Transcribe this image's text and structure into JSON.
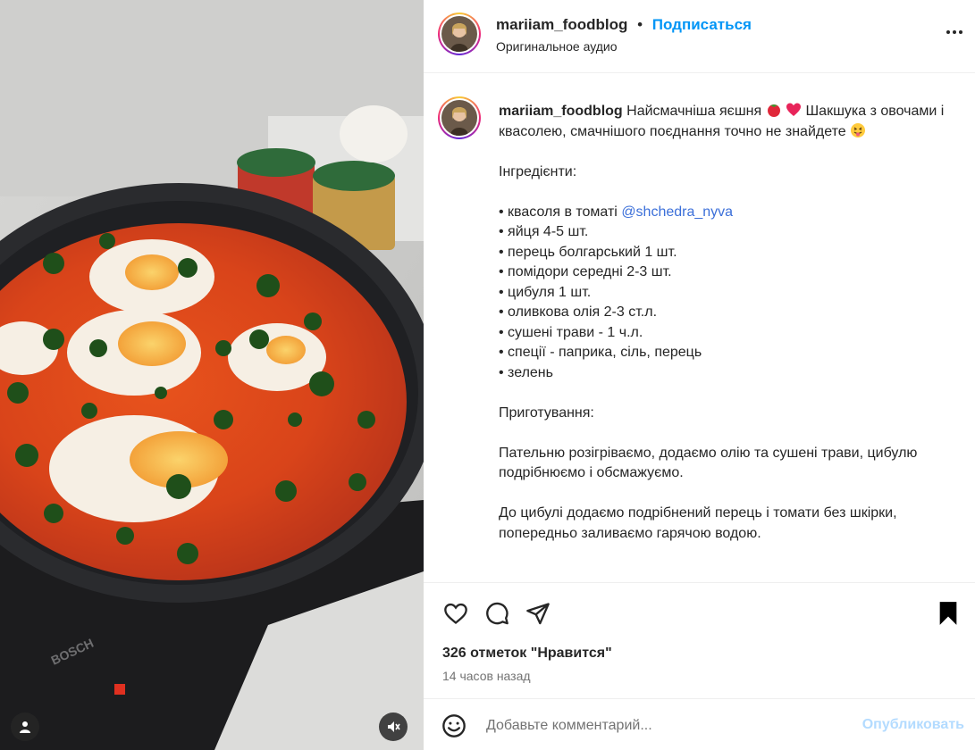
{
  "header": {
    "username": "mariiam_foodblog",
    "dot": "•",
    "follow_label": "Подписаться",
    "audio_label": "Оригинальное аудио",
    "more_icon": "more-horizontal-icon"
  },
  "caption": {
    "username": "mariiam_foodblog",
    "line1": "Найсмачніша яєшня",
    "line1b": "Шакшука з овочами і квасолею, смачнішого поєднання точно не знайдете",
    "ingredients_title": "Інгредієнти:",
    "items": {
      "i1": "• квасоля в томаті",
      "i1_mention": "@shchedra_nyva",
      "i2": "• яйця 4-5 шт.",
      "i3": "• перець болгарський 1 шт.",
      "i4": "• помідори середні 2-3 шт.",
      "i5": "• цибуля 1 шт.",
      "i6": "• оливкова олія 2-3 ст.л.",
      "i7": "• сушені трави - 1 ч.л.",
      "i8": "• спеції - паприка, сіль, перець",
      "i9": "• зелень"
    },
    "prep_title": "Приготування:",
    "step1": "Пательню розігріваємо, додаємо олію та сушені трави, цибулю подрібнюємо і обсмажуємо.",
    "step2": "До цибулі додаємо подрібнений перець і томати без шкірки, попередньо заливаємо гарячою водою."
  },
  "actions": {
    "likes": "326 отметок \"Нравится\"",
    "time": "14 часов назад"
  },
  "comment": {
    "placeholder": "Добавьте комментарий...",
    "publish_label": "Опубликовать"
  },
  "media": {
    "stove_brand": "BOSCH"
  },
  "colors": {
    "follow": "#0095f6",
    "mention": "#3b6fd9",
    "publish_disabled": "#b3dbff",
    "secondary_text": "#737373"
  }
}
